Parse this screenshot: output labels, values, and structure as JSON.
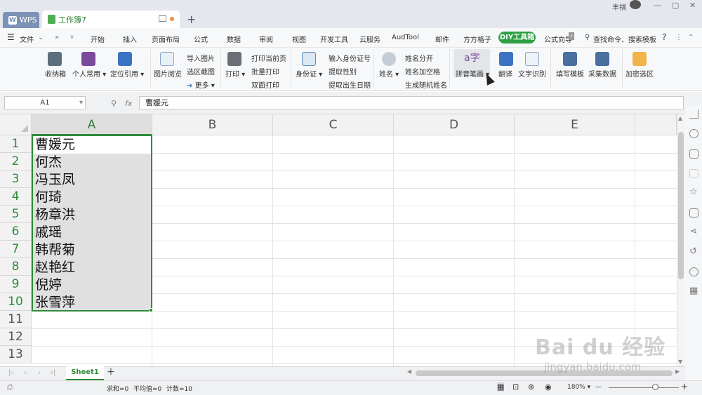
{
  "titlebar": {
    "wps_tab": "WPS",
    "doc_tab": "工作簿7",
    "user_name": "丰祺",
    "new_tab": "+"
  },
  "menu": {
    "file": "文件",
    "items": [
      "开始",
      "插入",
      "页面布局",
      "公式",
      "数据",
      "审阅",
      "视图",
      "开发工具",
      "云服务",
      "AudTool",
      "邮件",
      "方方格子",
      "DIY工具箱",
      "公式向导"
    ],
    "search": "查找命令、搜索模板",
    "help": "?"
  },
  "ribbon": {
    "shoujian": "收纳箱",
    "gerenchangyong": "个人常用",
    "dingweiyinyong": "定位引用",
    "tupianyuelan": "图片阅览",
    "daorutupian": "导入图片",
    "xuanqujietu": "选区截图",
    "gengduo": "更多",
    "dayin": "打印",
    "dayindangqianye": "打印当前页",
    "piliangdayin": "批量打印",
    "shuangmiandayin": "双面打印",
    "shenfenzheng": "身份证",
    "shurushenfenzhenghao": "输入身份证号",
    "tiquxingbie": "提取性别",
    "tiquchushengriqi": "提取出生日期",
    "xingming": "姓名",
    "xingmingfenkai": "姓名分开",
    "xingmingjiakongge": "姓名加空格",
    "shengchengsuijixingming": "生成随机姓名",
    "pinyinbihua": "拼音笔画",
    "fanyi": "翻译",
    "wenzishibie": "文字识别",
    "tianxiemoban": "填写模板",
    "caijishuju": "采集数据",
    "jiamixuanqu": "加密选区"
  },
  "formula_bar": {
    "name_box": "A1",
    "fx": "fx",
    "value": "曹媛元"
  },
  "grid": {
    "columns": [
      "A",
      "B",
      "C",
      "D",
      "E"
    ],
    "rows": [
      "1",
      "2",
      "3",
      "4",
      "5",
      "6",
      "7",
      "8",
      "9",
      "10",
      "11",
      "12",
      "13"
    ],
    "column_a_values": [
      "曹媛元",
      "何杰",
      "冯玉凤",
      "何琦",
      "杨章洪",
      "戚瑶",
      "韩帮菊",
      "赵艳红",
      "倪婷",
      "张雪萍"
    ]
  },
  "sheets": {
    "active": "Sheet1",
    "add": "+"
  },
  "status": {
    "sum": "求和=0",
    "avg": "平均值=0",
    "count": "计数=10",
    "zoom": "180%",
    "zoom_minus": "—",
    "zoom_plus": "+"
  },
  "watermark": {
    "main": "Bai du 经验",
    "sub": "jingyan.baidu.com"
  },
  "colors": {
    "accent_green": "#2e8b3a",
    "diy_active": "#2ea043",
    "wps_tab": "#7c91b6"
  }
}
